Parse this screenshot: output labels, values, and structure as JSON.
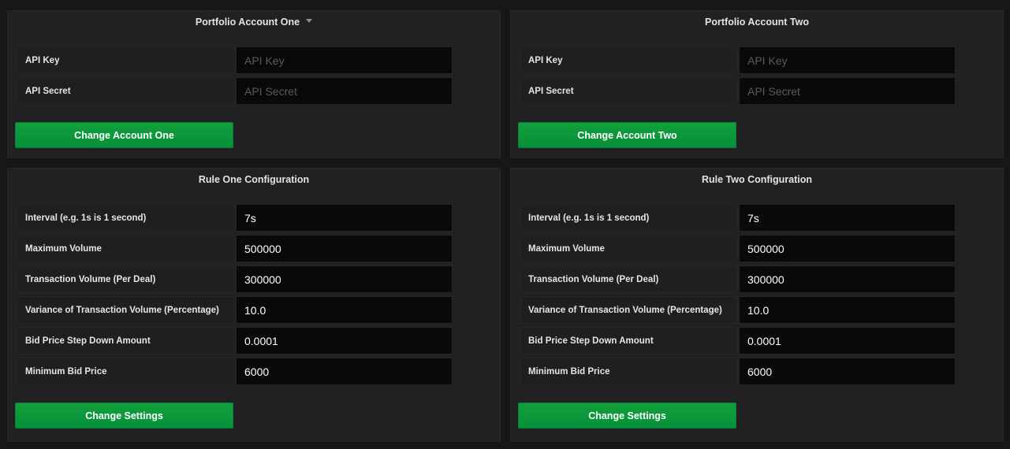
{
  "account_one": {
    "title": "Portfolio Account One",
    "api_key_label": "API Key",
    "api_key_placeholder": "API Key",
    "api_key_value": "",
    "api_secret_label": "API Secret",
    "api_secret_placeholder": "API Secret",
    "api_secret_value": "",
    "button_label": "Change Account One"
  },
  "account_two": {
    "title": "Portfolio Account Two",
    "api_key_label": "API Key",
    "api_key_placeholder": "API Key",
    "api_key_value": "",
    "api_secret_label": "API Secret",
    "api_secret_placeholder": "API Secret",
    "api_secret_value": "",
    "button_label": "Change Account Two"
  },
  "rule_one": {
    "title": "Rule One Configuration",
    "fields": [
      {
        "label": "Interval (e.g. 1s is 1 second)",
        "value": "7s"
      },
      {
        "label": "Maximum Volume",
        "value": "500000"
      },
      {
        "label": "Transaction Volume (Per Deal)",
        "value": "300000"
      },
      {
        "label": "Variance of Transaction Volume (Percentage)",
        "value": "10.0"
      },
      {
        "label": "Bid Price Step Down Amount",
        "value": "0.0001"
      },
      {
        "label": "Minimum Bid Price",
        "value": "6000"
      }
    ],
    "button_label": "Change Settings"
  },
  "rule_two": {
    "title": "Rule Two Configuration",
    "fields": [
      {
        "label": "Interval (e.g. 1s is 1 second)",
        "value": "7s"
      },
      {
        "label": "Maximum Volume",
        "value": "500000"
      },
      {
        "label": "Transaction Volume (Per Deal)",
        "value": "300000"
      },
      {
        "label": "Variance of Transaction Volume (Percentage)",
        "value": "10.0"
      },
      {
        "label": "Bid Price Step Down Amount",
        "value": "0.0001"
      },
      {
        "label": "Minimum Bid Price",
        "value": "6000"
      }
    ],
    "button_label": "Change Settings"
  },
  "theme": {
    "background": "#161719",
    "panel": "#212124",
    "accent_green": "#0a963a"
  }
}
